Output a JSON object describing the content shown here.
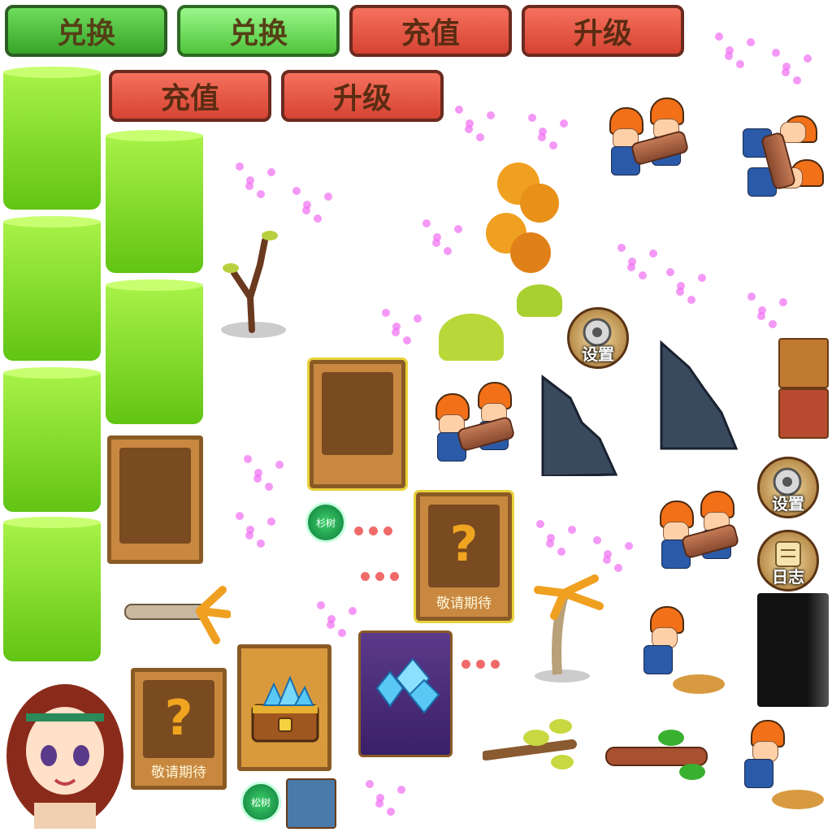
{
  "buttons": {
    "exchange_1": "兑换",
    "exchange_2": "兑换",
    "recharge_1": "充值",
    "upgrade_1": "升级",
    "recharge_2": "充值",
    "upgrade_2": "升级"
  },
  "cards": {
    "coming_soon_1": "敬请期待",
    "coming_soon_2": "敬请期待",
    "question_mark": "?"
  },
  "badges": {
    "fir": "杉树",
    "pine": "松树"
  },
  "menu": {
    "settings_1": "设置",
    "settings_2": "设置",
    "log": "日志"
  },
  "colors": {
    "button_green": "#38a52a",
    "button_red": "#d64332",
    "grass": "#7ed321",
    "card_brown": "#c88840",
    "helmet_orange": "#f27018",
    "sparkle_pink": "#f06cf2"
  }
}
